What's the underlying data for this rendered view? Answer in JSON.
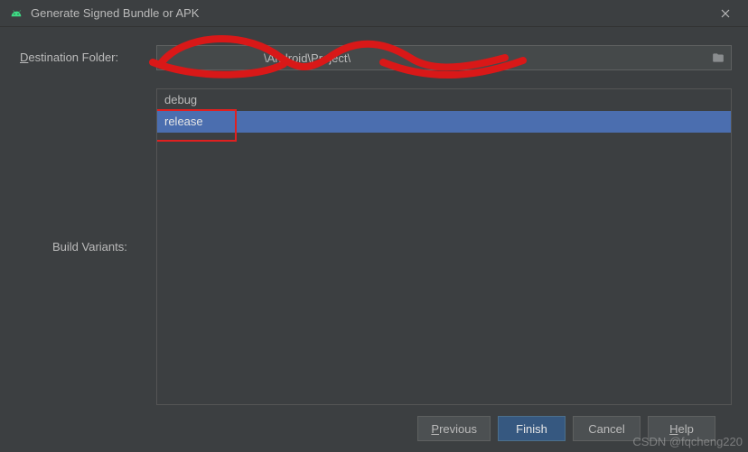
{
  "window": {
    "title": "Generate Signed Bundle or APK"
  },
  "labels": {
    "destination_prefix": "D",
    "destination_rest": "estination Folder:",
    "build_prefix": "B",
    "build_rest": "uild Variants:"
  },
  "destination": {
    "path": "\\Android\\Project\\"
  },
  "variants": {
    "items": [
      {
        "label": "debug",
        "selected": false
      },
      {
        "label": "release",
        "selected": true
      }
    ]
  },
  "buttons": {
    "previous_u": "P",
    "previous_rest": "revious",
    "finish": "Finish",
    "cancel": "Cancel",
    "help_u": "H",
    "help_rest": "elp"
  },
  "watermark": "CSDN @fqcheng220"
}
